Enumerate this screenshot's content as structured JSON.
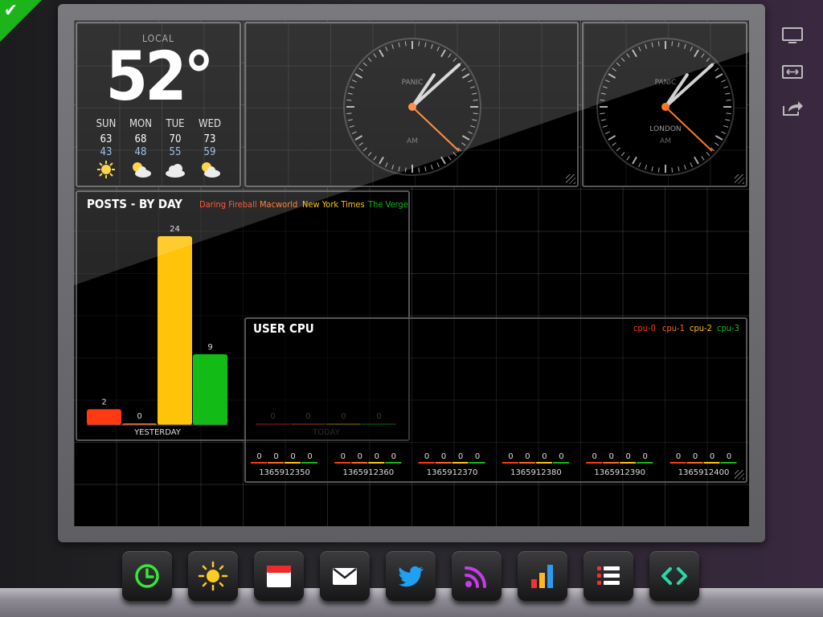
{
  "weather": {
    "label": "LOCAL",
    "temperature": "52°",
    "forecast": [
      {
        "day": "SUN",
        "high": "63",
        "low": "43",
        "icon": "sun-icon"
      },
      {
        "day": "MON",
        "high": "68",
        "low": "48",
        "icon": "partly-cloudy-icon"
      },
      {
        "day": "TUE",
        "high": "70",
        "low": "55",
        "icon": "cloud-icon"
      },
      {
        "day": "WED",
        "high": "73",
        "low": "59",
        "icon": "partly-cloudy-icon"
      }
    ]
  },
  "clocks": [
    {
      "label": "PANIC",
      "ampm": "AM",
      "city": "",
      "time": "1:08"
    },
    {
      "label": "PANIC",
      "ampm": "AM",
      "city": "LONDON",
      "time": "1:08"
    }
  ],
  "posts": {
    "title": "POSTS - BY DAY",
    "legend": [
      {
        "name": "Daring Fireball",
        "color": "#ff3a12"
      },
      {
        "name": "Macworld",
        "color": "#ff6a16"
      },
      {
        "name": "New York Times",
        "color": "#ffc30a"
      },
      {
        "name": "The Verge",
        "color": "#12bb16"
      }
    ],
    "yesterday_label": "YESTERDAY",
    "today_label": "TODAY"
  },
  "cpu": {
    "title": "USER CPU",
    "legend": [
      {
        "name": "cpu-0",
        "color": "#ff3a12"
      },
      {
        "name": "cpu-1",
        "color": "#ff6a16"
      },
      {
        "name": "cpu-2",
        "color": "#ffc30a"
      },
      {
        "name": "cpu-3",
        "color": "#12bb16"
      }
    ]
  },
  "chart_data": [
    {
      "type": "bar",
      "title": "POSTS - BY DAY",
      "categories": [
        "YESTERDAY",
        "TODAY"
      ],
      "series": [
        {
          "name": "Daring Fireball",
          "values": [
            2,
            0
          ]
        },
        {
          "name": "Macworld",
          "values": [
            0,
            0
          ]
        },
        {
          "name": "New York Times",
          "values": [
            24,
            0
          ]
        },
        {
          "name": "The Verge",
          "values": [
            9,
            0
          ]
        }
      ],
      "ylim": [
        0,
        24
      ],
      "grid": true,
      "legend": "top-right"
    },
    {
      "type": "bar",
      "title": "USER CPU",
      "categories": [
        "1365912350",
        "1365912360",
        "1365912370",
        "1365912380",
        "1365912390",
        "1365912400"
      ],
      "series": [
        {
          "name": "cpu-0",
          "values": [
            0,
            0,
            0,
            0,
            0,
            0
          ]
        },
        {
          "name": "cpu-1",
          "values": [
            0,
            0,
            0,
            0,
            0,
            0
          ]
        },
        {
          "name": "cpu-2",
          "values": [
            0,
            0,
            0,
            0,
            0,
            0
          ]
        },
        {
          "name": "cpu-3",
          "values": [
            0,
            0,
            0,
            0,
            0,
            0
          ]
        }
      ],
      "grid": true,
      "legend": "top-right"
    }
  ],
  "toolbar": [
    {
      "icon": "monitor-icon"
    },
    {
      "icon": "resize-icon"
    },
    {
      "icon": "share-icon"
    }
  ],
  "dock": [
    {
      "icon": "clock-icon",
      "color": "#39e639"
    },
    {
      "icon": "sun-icon",
      "color": "#ffcc22"
    },
    {
      "icon": "calendar-icon",
      "color": "#ee2a2a"
    },
    {
      "icon": "mail-icon",
      "color": "#ffffff"
    },
    {
      "icon": "twitter-icon",
      "color": "#1ea1f2"
    },
    {
      "icon": "rss-icon",
      "color": "#c93be8"
    },
    {
      "icon": "bar-chart-icon",
      "color": "#ffb822"
    },
    {
      "icon": "list-icon",
      "color": "#ee3333"
    },
    {
      "icon": "code-icon",
      "color": "#22dda8"
    }
  ]
}
